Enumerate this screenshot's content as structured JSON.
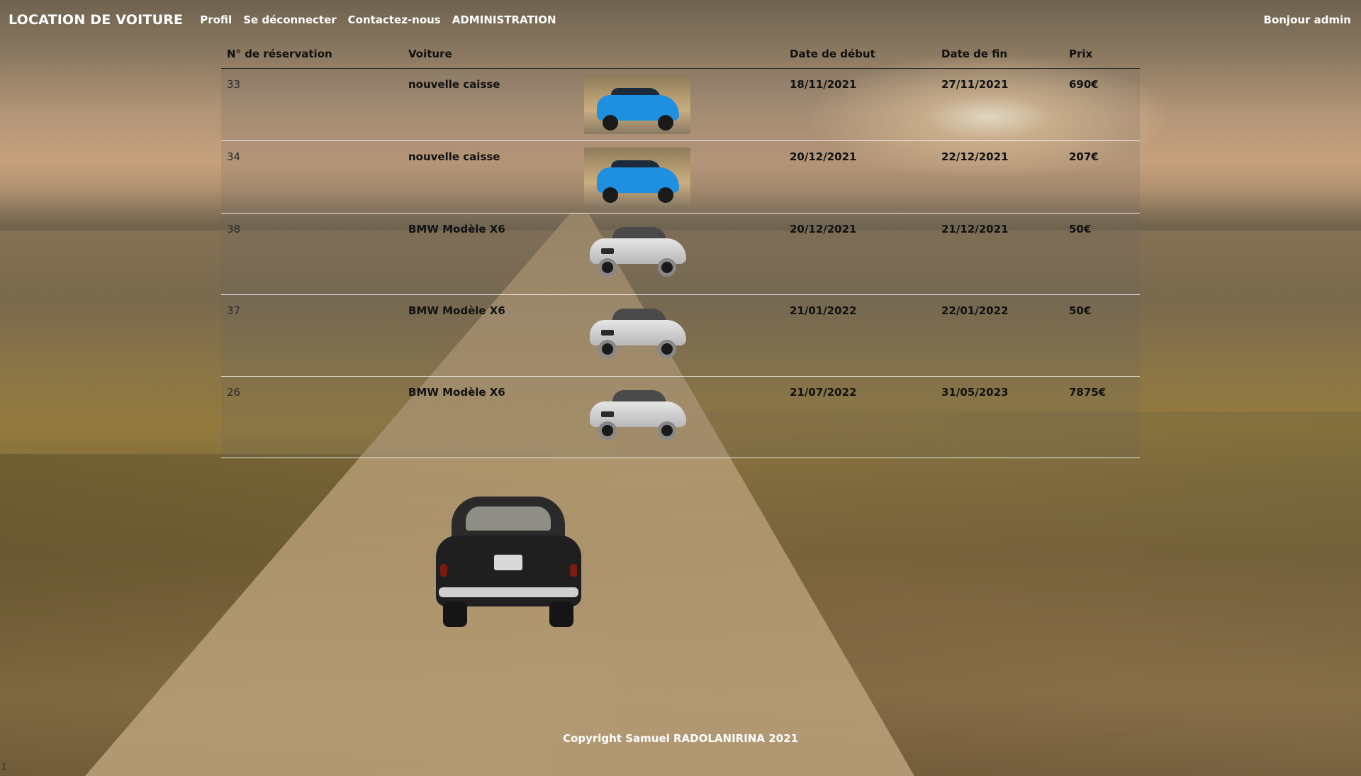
{
  "navbar": {
    "brand": "LOCATION DE VOITURE",
    "links": [
      "Profil",
      "Se déconnecter",
      "Contactez-nous",
      "ADMINISTRATION"
    ],
    "greeting": "Bonjour admin"
  },
  "table": {
    "headers": [
      "N° de réservation",
      "Voiture",
      "",
      "Date de début",
      "Date de fin",
      "Prix"
    ],
    "rows": [
      {
        "id": "33",
        "car": "nouvelle caisse",
        "image": "blue-suv-icon",
        "start": "18/11/2021",
        "end": "27/11/2021",
        "price": "690€"
      },
      {
        "id": "34",
        "car": "nouvelle caisse",
        "image": "blue-suv-icon",
        "start": "20/12/2021",
        "end": "22/12/2021",
        "price": "207€"
      },
      {
        "id": "38",
        "car": "BMW Modèle X6",
        "image": "silver-bmw-icon",
        "start": "20/12/2021",
        "end": "21/12/2021",
        "price": "50€"
      },
      {
        "id": "37",
        "car": "BMW Modèle X6",
        "image": "silver-bmw-icon",
        "start": "21/01/2022",
        "end": "22/01/2022",
        "price": "50€"
      },
      {
        "id": "26",
        "car": "BMW Modèle X6",
        "image": "silver-bmw-icon",
        "start": "21/07/2022",
        "end": "31/05/2023",
        "price": "7875€"
      }
    ]
  },
  "footer": {
    "copyright": "Copyright Samuel RADOLANIRINA 2021"
  },
  "corner_text": "1",
  "colors": {
    "nav_text": "#ffffff",
    "table_text": "#111111",
    "row_divider": "#ffffff"
  }
}
